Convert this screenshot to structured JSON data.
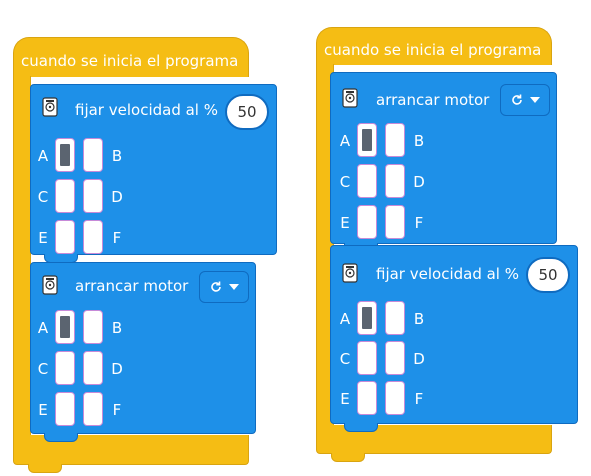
{
  "left_stack": {
    "hat_title": "cuando se inicia el programa",
    "block1": {
      "label": "fijar velocidad al %",
      "value": "50",
      "ports": [
        [
          "A",
          "B"
        ],
        [
          "C",
          "D"
        ],
        [
          "E",
          "F"
        ]
      ],
      "selected_port": "A"
    },
    "block2": {
      "label": "arrancar motor",
      "direction": "clockwise",
      "ports": [
        [
          "A",
          "B"
        ],
        [
          "C",
          "D"
        ],
        [
          "E",
          "F"
        ]
      ],
      "selected_port": "A"
    }
  },
  "right_stack": {
    "hat_title": "cuando se inicia el programa",
    "block1": {
      "label": "arrancar motor",
      "direction": "clockwise",
      "ports": [
        [
          "A",
          "B"
        ],
        [
          "C",
          "D"
        ],
        [
          "E",
          "F"
        ]
      ],
      "selected_port": "A"
    },
    "block2": {
      "label": "fijar velocidad al %",
      "value": "50",
      "ports": [
        [
          "A",
          "B"
        ],
        [
          "C",
          "D"
        ],
        [
          "E",
          "F"
        ]
      ],
      "selected_port": "A"
    }
  },
  "icons": {
    "motor": "motor-icon",
    "direction": "clockwise-icon",
    "dropdown": "chevron-down-icon"
  },
  "colors": {
    "hat": "#F5BD14",
    "block": "#1E90E8",
    "block_border": "#0F6BC0",
    "port_selected": "#5B6470"
  }
}
